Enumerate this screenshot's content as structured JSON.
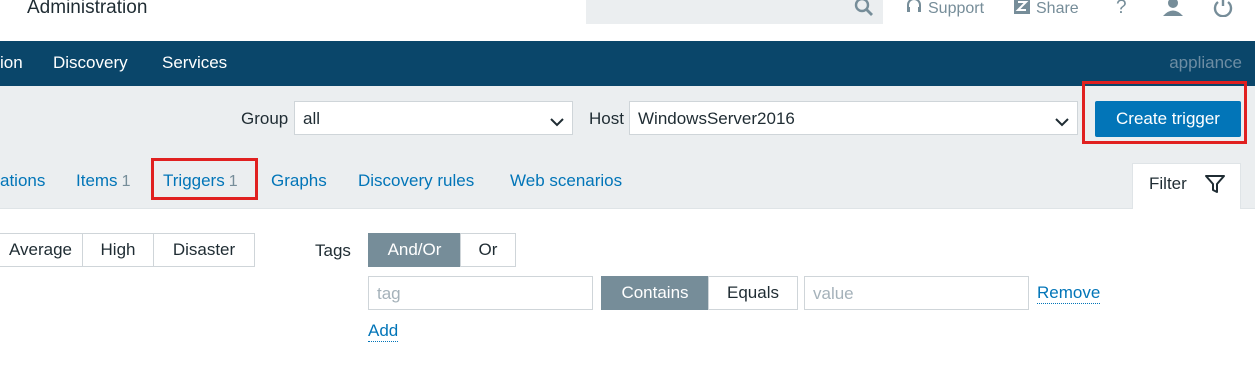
{
  "header": {
    "title": "Administration",
    "support_label": "Support",
    "share_label": "Share",
    "help_label": "?"
  },
  "nav": {
    "items": [
      "ion",
      "Discovery",
      "Services"
    ],
    "right": "appliance"
  },
  "filters": {
    "group_label": "Group",
    "group_value": "all",
    "host_label": "Host",
    "host_value": "WindowsServer2016",
    "create_label": "Create trigger"
  },
  "tabs": [
    {
      "label": "ations",
      "count": ""
    },
    {
      "label": "Items",
      "count": "1"
    },
    {
      "label": "Triggers",
      "count": "1"
    },
    {
      "label": "Graphs",
      "count": ""
    },
    {
      "label": "Discovery rules",
      "count": ""
    },
    {
      "label": "Web scenarios",
      "count": ""
    }
  ],
  "filter_tab": {
    "label": "Filter"
  },
  "severity": {
    "buttons": [
      "Average",
      "High",
      "Disaster"
    ]
  },
  "tags": {
    "label": "Tags",
    "mode_options": [
      "And/Or",
      "Or"
    ],
    "tag_placeholder": "tag",
    "operators": [
      "Contains",
      "Equals"
    ],
    "value_placeholder": "value",
    "remove_label": "Remove",
    "add_label": "Add"
  },
  "colors": {
    "nav_bg": "#0a466a",
    "accent": "#0275b8",
    "highlight": "#e02020",
    "active_seg": "#768d99"
  }
}
